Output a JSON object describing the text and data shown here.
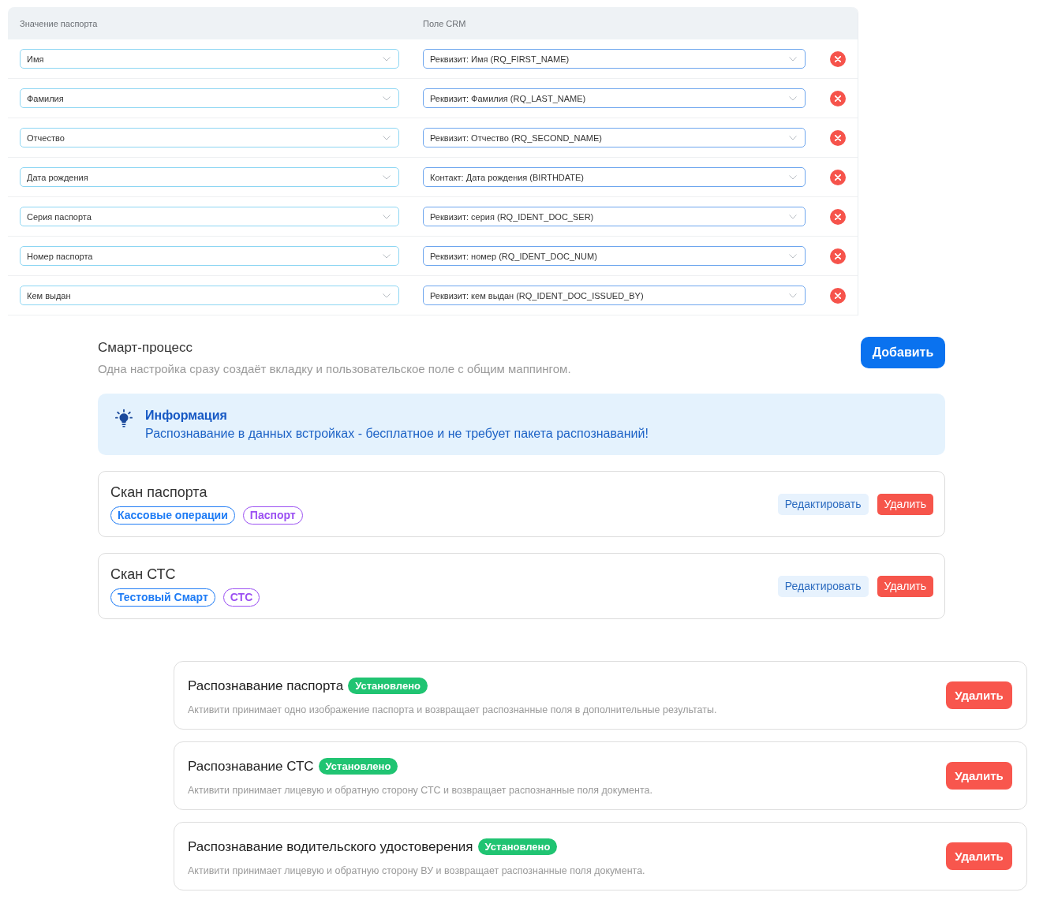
{
  "mapping_table": {
    "columns": [
      "Значение паспорта",
      "Поле CRM"
    ],
    "rows": [
      {
        "passport_value": "Имя",
        "crm_field": "Реквизит: Имя (RQ_FIRST_NAME)"
      },
      {
        "passport_value": "Фамилия",
        "crm_field": "Реквизит: Фамилия (RQ_LAST_NAME)"
      },
      {
        "passport_value": "Отчество",
        "crm_field": "Реквизит: Отчество (RQ_SECOND_NAME)"
      },
      {
        "passport_value": "Дата рождения",
        "crm_field": "Контакт: Дата рождения (BIRTHDATE)"
      },
      {
        "passport_value": "Серия паспорта",
        "crm_field": "Реквизит: серия (RQ_IDENT_DOC_SER)"
      },
      {
        "passport_value": "Номер паспорта",
        "crm_field": "Реквизит: номер (RQ_IDENT_DOC_NUM)"
      },
      {
        "passport_value": "Кем выдан",
        "crm_field": "Реквизит: кем выдан (RQ_IDENT_DOC_ISSUED_BY)"
      }
    ]
  },
  "smart_process": {
    "title": "Смарт-процесс",
    "subtitle": "Одна настройка сразу создаёт вкладку и пользовательское поле с общим маппингом.",
    "add_button": "Добавить",
    "info": {
      "title": "Информация",
      "text": "Распознавание в данных встройках - бесплатное и не требует пакета распознаваний!"
    },
    "items": [
      {
        "title": "Скан паспорта",
        "tags": [
          {
            "label": "Кассовые операции",
            "color": "#1f7cf5"
          },
          {
            "label": "Паспорт",
            "color": "#9b50f2"
          }
        ],
        "edit_button": "Редактировать",
        "delete_button": "Удалить"
      },
      {
        "title": "Скан СТС",
        "tags": [
          {
            "label": "Тестовый Смарт",
            "color": "#1f7cf5"
          },
          {
            "label": "СТС",
            "color": "#9b50f2"
          }
        ],
        "edit_button": "Редактировать",
        "delete_button": "Удалить"
      }
    ]
  },
  "activities": [
    {
      "title": "Распознавание паспорта",
      "badge": "Установлено",
      "description": "Активити принимает одно изображение паспорта и возвращает распознанные поля в дополнительные результаты.",
      "delete_button": "Удалить"
    },
    {
      "title": "Распознавание СТС",
      "badge": "Установлено",
      "description": "Активити принимает лицевую и обратную сторону СТС и возвращает распознанные поля документа.",
      "delete_button": "Удалить"
    },
    {
      "title": "Распознавание водительского удостоверения",
      "badge": "Установлено",
      "description": "Активити принимает лицевую и обратную сторону ВУ и возвращает распознанные поля документа.",
      "delete_button": "Удалить"
    }
  ]
}
